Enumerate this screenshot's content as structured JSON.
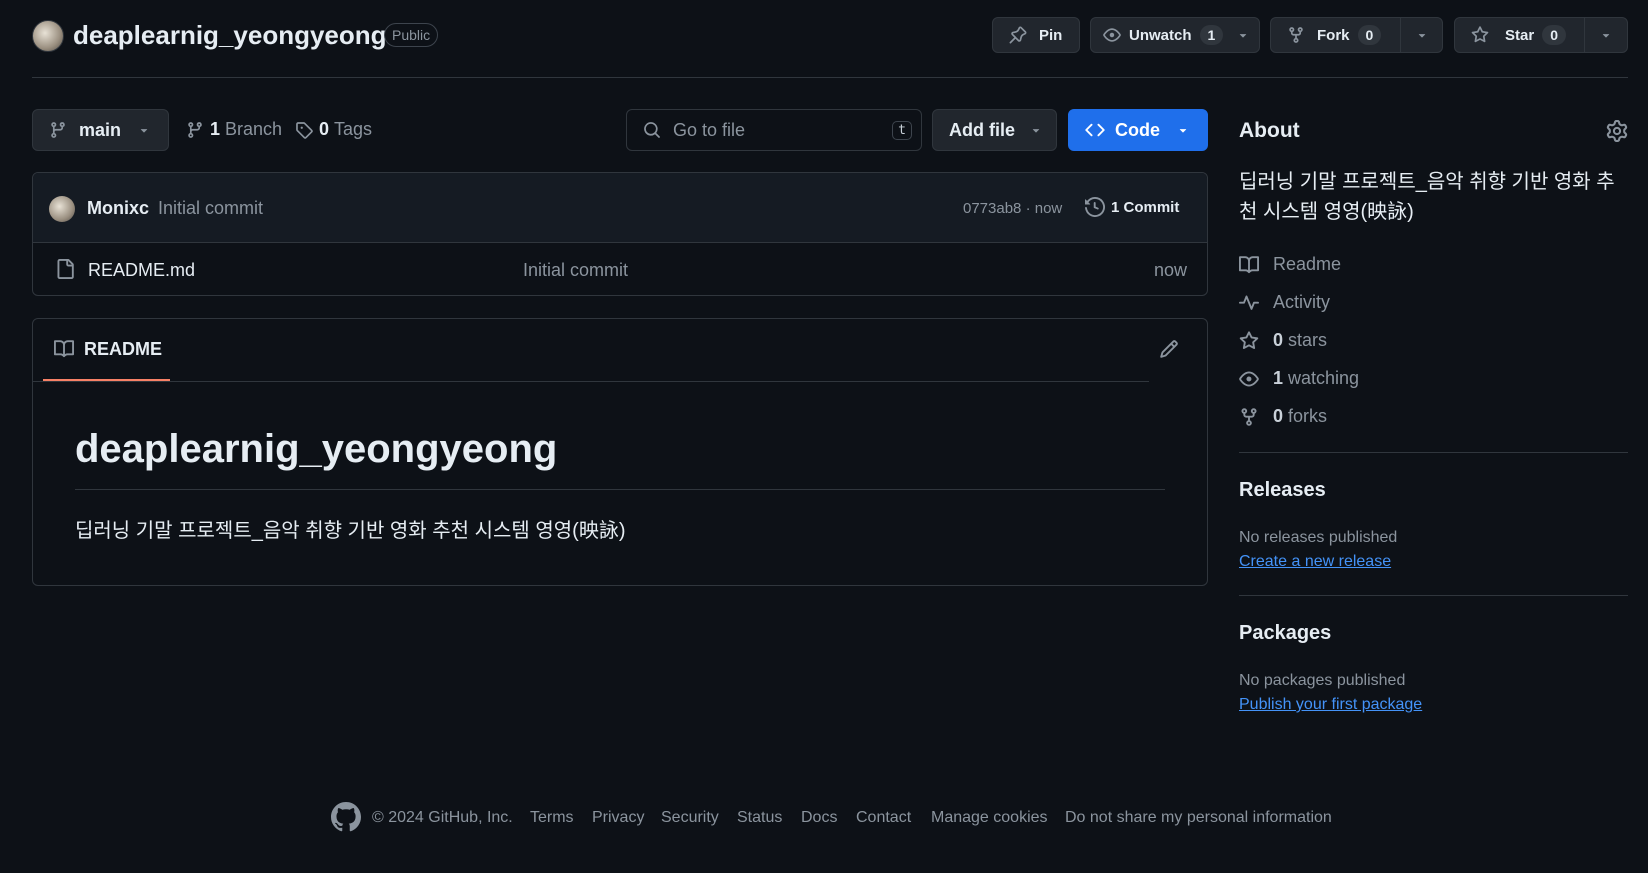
{
  "repo": {
    "name": "deaplearnig_yeongyeong",
    "visibility": "Public"
  },
  "header_actions": {
    "pin_label": "Pin",
    "unwatch_label": "Unwatch",
    "watch_count": "1",
    "fork_label": "Fork",
    "fork_count": "0",
    "star_label": "Star",
    "star_count": "0"
  },
  "toolbar": {
    "branch_name": "main",
    "branch_count": "1",
    "branch_label": "Branch",
    "tag_count": "0",
    "tag_label": "Tags",
    "go_to_file_placeholder": "Go to file",
    "go_to_file_shortcut": "t",
    "add_file_label": "Add file",
    "code_label": "Code"
  },
  "latest_commit": {
    "author": "Monixc",
    "message": "Initial commit",
    "hash_time": "0773ab8 · now",
    "commit_count_label": "1 Commit"
  },
  "files": [
    {
      "name": "README.md",
      "message": "Initial commit",
      "time": "now"
    }
  ],
  "readme": {
    "tab_label": "README",
    "heading": "deaplearnig_yeongyeong",
    "body": "딥러닝 기말 프로젝트_음악 취향 기반 영화 추천 시스템 영영(映詠)"
  },
  "about": {
    "title": "About",
    "description": "딥러닝 기말 프로젝트_음악 취향 기반 영화 추천 시스템 영영(映詠)",
    "readme_label": "Readme",
    "activity_label": "Activity",
    "stars_count": "0",
    "stars_label": "stars",
    "watching_count": "1",
    "watching_label": "watching",
    "forks_count": "0",
    "forks_label": "forks"
  },
  "releases": {
    "title": "Releases",
    "empty_text": "No releases published",
    "create_link": "Create a new release"
  },
  "packages": {
    "title": "Packages",
    "empty_text": "No packages published",
    "publish_link": "Publish your first package"
  },
  "footer": {
    "copyright": "© 2024 GitHub, Inc.",
    "links": [
      "Terms",
      "Privacy",
      "Security",
      "Status",
      "Docs",
      "Contact",
      "Manage cookies",
      "Do not share my personal information"
    ]
  },
  "colors": {
    "background": "#0d1117",
    "border": "#30363d",
    "primary_button": "#1f6feb",
    "link": "#4493f8",
    "tab_underline": "#f78166"
  }
}
